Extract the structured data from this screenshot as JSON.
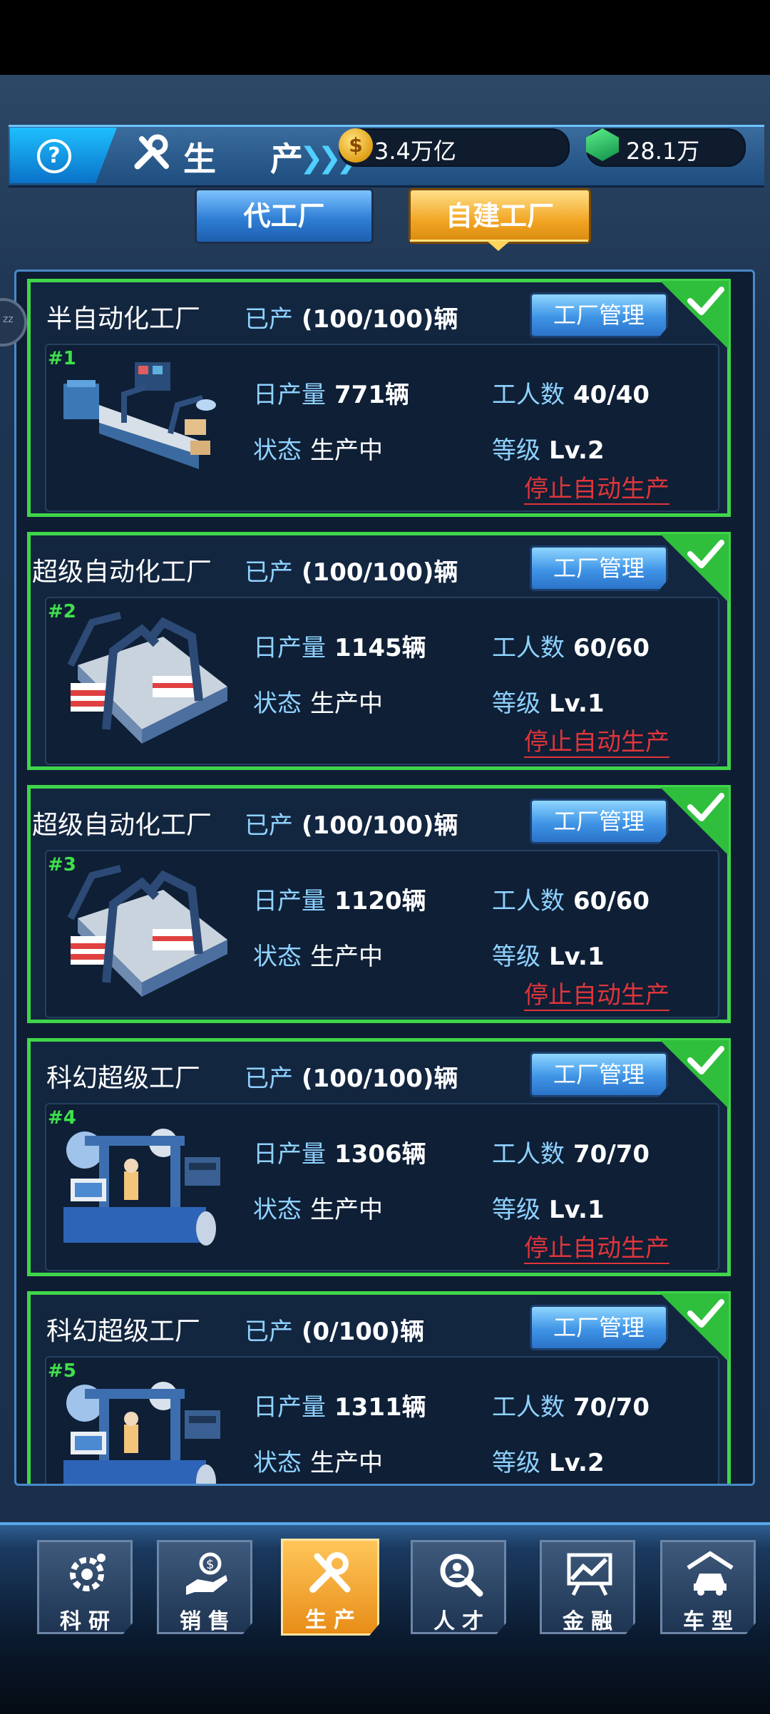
{
  "header": {
    "title": "生 产",
    "help_symbol": "?",
    "coins": "3.4万亿",
    "gems": "28.1万"
  },
  "tabs": [
    {
      "label": "代工厂",
      "active": false
    },
    {
      "label": "自建工厂",
      "active": true
    }
  ],
  "side_handle_text": "zz",
  "labels": {
    "produced": "已产",
    "daily_output": "日产量",
    "workers": "工人数",
    "status": "状态",
    "level": "等级",
    "manage": "工厂管理",
    "stop": "停止自动生产"
  },
  "factories": [
    {
      "index": "#1",
      "name": "半自动化工厂",
      "produced": "(100/100)辆",
      "daily": "771辆",
      "workers": "40/40",
      "status": "生产中",
      "level": "Lv.2",
      "checked": true
    },
    {
      "index": "#2",
      "name": "超级自动化工厂",
      "produced": "(100/100)辆",
      "daily": "1145辆",
      "workers": "60/60",
      "status": "生产中",
      "level": "Lv.1",
      "checked": true
    },
    {
      "index": "#3",
      "name": "超级自动化工厂",
      "produced": "(100/100)辆",
      "daily": "1120辆",
      "workers": "60/60",
      "status": "生产中",
      "level": "Lv.1",
      "checked": true
    },
    {
      "index": "#4",
      "name": "科幻超级工厂",
      "produced": "(100/100)辆",
      "daily": "1306辆",
      "workers": "70/70",
      "status": "生产中",
      "level": "Lv.1",
      "checked": true
    },
    {
      "index": "#5",
      "name": "科幻超级工厂",
      "produced": "(0/100)辆",
      "daily": "1311辆",
      "workers": "70/70",
      "status": "生产中",
      "level": "Lv.2",
      "checked": true
    }
  ],
  "nav": [
    {
      "label": "科研",
      "icon": "research-gear-icon",
      "active": false
    },
    {
      "label": "销售",
      "icon": "sales-hand-money-icon",
      "active": false
    },
    {
      "label": "生产",
      "icon": "wrench-screwdriver-icon",
      "active": true
    },
    {
      "label": "人才",
      "icon": "talent-magnifier-icon",
      "active": false
    },
    {
      "label": "金融",
      "icon": "finance-chart-icon",
      "active": false
    },
    {
      "label": "车型",
      "icon": "car-garage-icon",
      "active": false
    }
  ],
  "colors": {
    "accent_green": "#3fd64a",
    "stop_red": "#e0353a",
    "label_blue": "#8fd2ff",
    "active_orange": "#f2a523"
  }
}
